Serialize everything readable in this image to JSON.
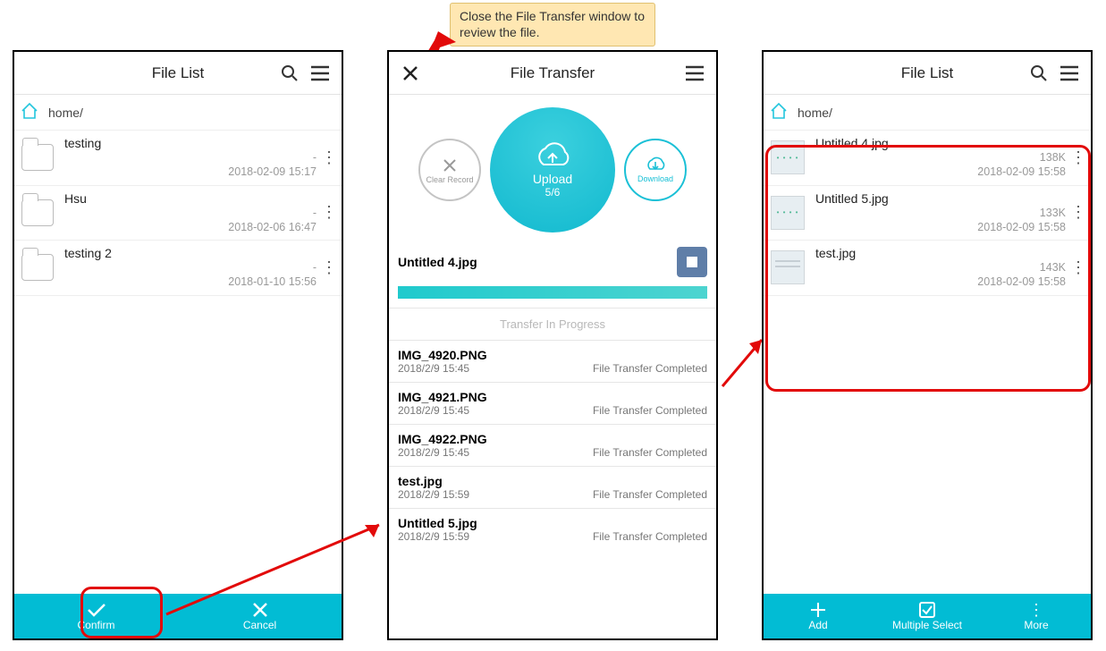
{
  "callout": "Close the File Transfer window to review the file.",
  "screenA": {
    "title": "File List",
    "breadcrumb": "home/",
    "items": [
      {
        "name": "testing",
        "size": "-",
        "date": "2018-02-09 15:17"
      },
      {
        "name": "Hsu",
        "size": "-",
        "date": "2018-02-06 16:47"
      },
      {
        "name": "testing 2",
        "size": "-",
        "date": "2018-01-10 15:56"
      }
    ],
    "toolbar": {
      "confirm": "Confirm",
      "cancel": "Cancel"
    }
  },
  "screenB": {
    "title": "File Transfer",
    "clear_label": "Clear Record",
    "download_label": "Download",
    "upload_label": "Upload",
    "upload_count": "5/6",
    "current_file": "Untitled 4.jpg",
    "section_header": "Transfer In Progress",
    "completed_label": "File Transfer Completed",
    "items": [
      {
        "name": "IMG_4920.PNG",
        "date": "2018/2/9 15:45"
      },
      {
        "name": "IMG_4921.PNG",
        "date": "2018/2/9 15:45"
      },
      {
        "name": "IMG_4922.PNG",
        "date": "2018/2/9 15:45"
      },
      {
        "name": "test.jpg",
        "date": "2018/2/9 15:59"
      },
      {
        "name": "Untitled 5.jpg",
        "date": "2018/2/9 15:59"
      }
    ]
  },
  "screenC": {
    "title": "File List",
    "breadcrumb": "home/",
    "items": [
      {
        "name": "Untitled 4.jpg",
        "size": "138K",
        "date": "2018-02-09 15:58",
        "thumb": "dots"
      },
      {
        "name": "Untitled 5.jpg",
        "size": "133K",
        "date": "2018-02-09 15:58",
        "thumb": "dots"
      },
      {
        "name": "test.jpg",
        "size": "143K",
        "date": "2018-02-09 15:58",
        "thumb": "lines"
      }
    ],
    "toolbar": {
      "add": "Add",
      "multi": "Multiple Select",
      "more": "More"
    }
  }
}
